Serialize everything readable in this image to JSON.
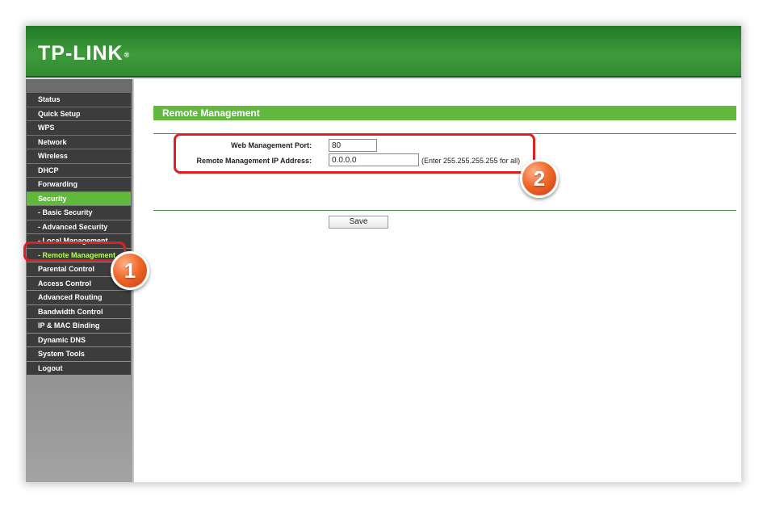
{
  "header": {
    "logo_text": "TP-LINK",
    "logo_mark": "®"
  },
  "sidebar": {
    "items": [
      "Status",
      "Quick Setup",
      "WPS",
      "Network",
      "Wireless",
      "DHCP",
      "Forwarding",
      "Security",
      "- Basic Security",
      "- Advanced Security",
      "- Local Management",
      "- Remote Management",
      "Parental Control",
      "Access Control",
      "Advanced Routing",
      "Bandwidth Control",
      "IP & MAC Binding",
      "Dynamic DNS",
      "System Tools",
      "Logout"
    ],
    "active_item": "Security",
    "current_item": "- Remote Management"
  },
  "main": {
    "section_title": "Remote Management",
    "web_port_label": "Web Management Port:",
    "web_port_value": "80",
    "ip_label": "Remote Management IP Address:",
    "ip_value": "0.0.0.0",
    "ip_hint": "(Enter 255.255.255.255 for all)",
    "save_label": "Save"
  },
  "annotations": {
    "badge_1": "1",
    "badge_2": "2"
  },
  "colors": {
    "header_green": "#3f9a3a",
    "menu_bg": "#3c3c3c",
    "menu_active": "#5fb93a",
    "section_bar": "#63b93e",
    "callout_red": "#e02020",
    "badge_orange": "#f06a2a"
  }
}
